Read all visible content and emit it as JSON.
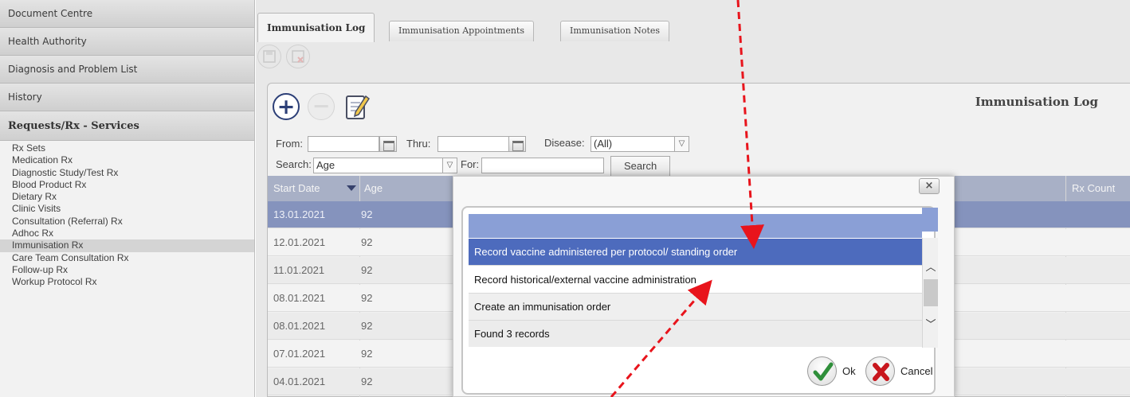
{
  "sidebar": {
    "sections": [
      "Document Centre",
      "Health Authority",
      "Diagnosis and Problem List",
      "History"
    ],
    "group_title": "Requests/Rx - Services",
    "items": [
      {
        "label": "Rx Sets",
        "selected": false
      },
      {
        "label": "Medication Rx",
        "selected": false
      },
      {
        "label": "Diagnostic Study/Test Rx",
        "selected": false
      },
      {
        "label": "Blood Product Rx",
        "selected": false
      },
      {
        "label": "Dietary Rx",
        "selected": false
      },
      {
        "label": "Clinic Visits",
        "selected": false
      },
      {
        "label": "Consultation (Referral) Rx",
        "selected": false
      },
      {
        "label": "Adhoc Rx",
        "selected": false
      },
      {
        "label": "Immunisation Rx",
        "selected": true
      },
      {
        "label": "Care Team Consultation Rx",
        "selected": false
      },
      {
        "label": "Follow-up Rx",
        "selected": false
      },
      {
        "label": "Workup Protocol Rx",
        "selected": false
      }
    ]
  },
  "tabs": [
    {
      "label": "Immunisation Log",
      "active": true
    },
    {
      "label": "Immunisation Appointments",
      "active": false
    },
    {
      "label": "Immunisation Notes",
      "active": false
    }
  ],
  "toolbar": {
    "save_icon": "save-icon",
    "save_close_icon": "save-close-icon"
  },
  "panel": {
    "title": "Immunisation Log",
    "add_icon": "plus-icon",
    "remove_icon": "minus-icon",
    "edit_icon": "edit-notepad-icon"
  },
  "filters": {
    "from_label": "From:",
    "from_value": "",
    "thru_label": "Thru:",
    "thru_value": "",
    "disease_label": "Disease:",
    "disease_value": "(All)",
    "search_label": "Search:",
    "search_value": "Age",
    "for_label": "For:",
    "for_value": "",
    "search_button": "Search"
  },
  "grid": {
    "columns": [
      "Start Date",
      "Age",
      "Rx Count"
    ],
    "sort_column": "Start Date",
    "rows": [
      {
        "start_date": "13.01.2021",
        "age": "92",
        "selected": true
      },
      {
        "start_date": "12.01.2021",
        "age": "92",
        "selected": false
      },
      {
        "start_date": "11.01.2021",
        "age": "92",
        "selected": false
      },
      {
        "start_date": "08.01.2021",
        "age": "92",
        "selected": false
      },
      {
        "start_date": "08.01.2021",
        "age": "92",
        "selected": false
      },
      {
        "start_date": "07.01.2021",
        "age": "92",
        "selected": false
      },
      {
        "start_date": "04.01.2021",
        "age": "92",
        "selected": false
      }
    ]
  },
  "dialog": {
    "close_label": "×",
    "options": [
      {
        "label": "Record vaccine administered per protocol/ standing order",
        "selected": true
      },
      {
        "label": "Record historical/external vaccine administration",
        "selected": false
      },
      {
        "label": "Create an immunisation order",
        "selected": false
      }
    ],
    "record_count": "Found 3 records",
    "ok_label": "Ok",
    "cancel_label": "Cancel"
  },
  "colors": {
    "grid_selected_row": "#8593bd",
    "dialog_selected_option": "#4d6bbd",
    "annotation_arrow": "#e8141c",
    "ok_check": "#2f8f3a",
    "cancel_x": "#c8161d"
  }
}
